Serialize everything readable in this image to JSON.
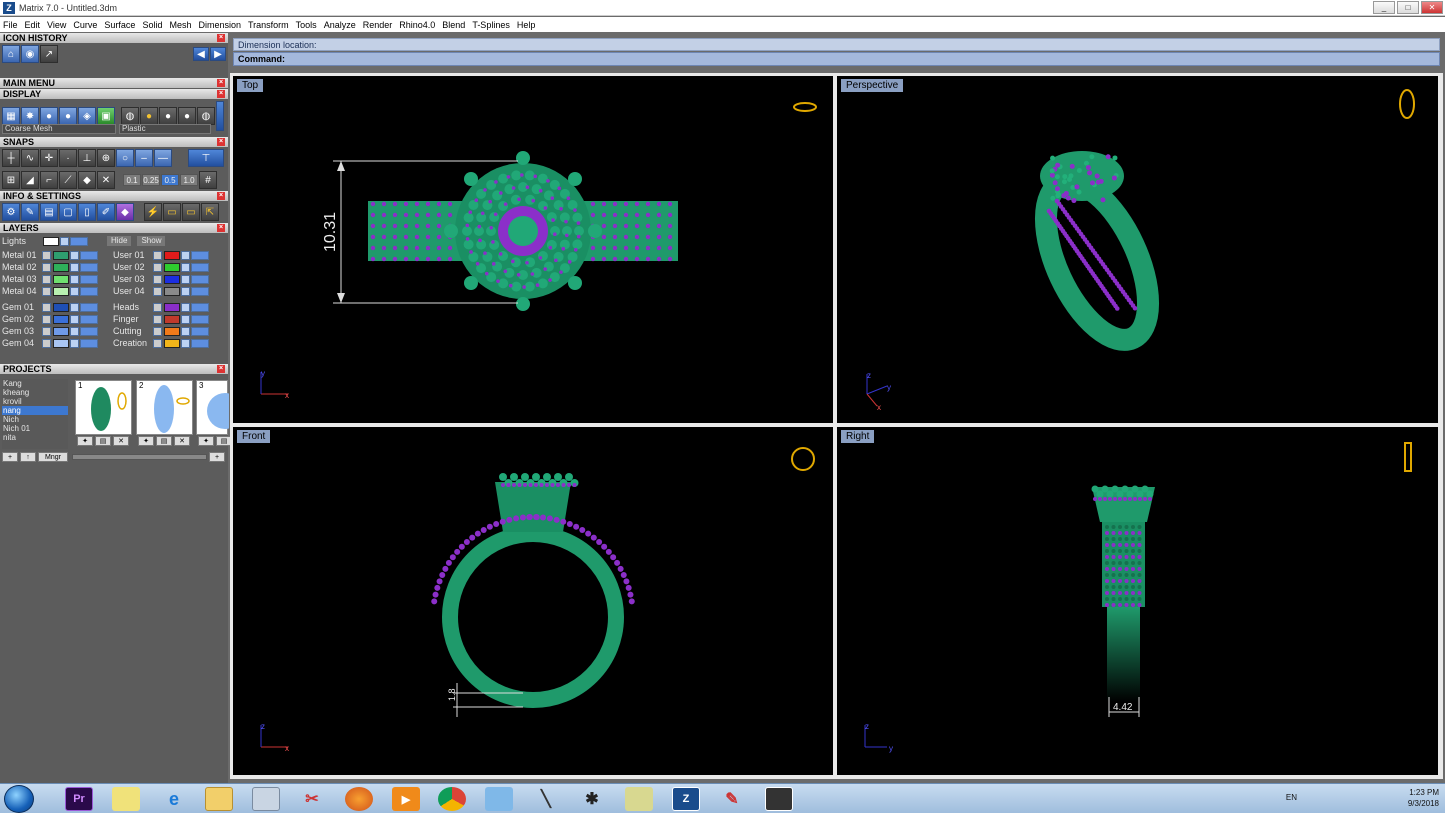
{
  "window": {
    "title": "Matrix 7.0 - Untitled.3dm",
    "logo": "Z",
    "min": "_",
    "max": "□",
    "close": "✕"
  },
  "menu": [
    "File",
    "Edit",
    "View",
    "Curve",
    "Surface",
    "Solid",
    "Mesh",
    "Dimension",
    "Transform",
    "Tools",
    "Analyze",
    "Render",
    "Rhino4.0",
    "Blend",
    "T-Splines",
    "Help"
  ],
  "panels": {
    "icon_history": "ICON HISTORY",
    "main_menu": "MAIN MENU",
    "display": "DISPLAY",
    "display_mode": "Coarse Mesh",
    "display_material": "Plastic",
    "snaps": "SNAPS",
    "snap_values": [
      "0.1",
      "0.25",
      "0.5",
      "1.0"
    ],
    "info_settings": "INFO & SETTINGS",
    "layers": "LAYERS",
    "projects": "PROJECTS"
  },
  "layers": {
    "lights": "Lights",
    "hide": "Hide",
    "show": "Show",
    "left": [
      {
        "name": "Metal 01",
        "color": "#2e9e6f"
      },
      {
        "name": "Metal 02",
        "color": "#2eb05a"
      },
      {
        "name": "Metal 03",
        "color": "#6fe06f"
      },
      {
        "name": "Metal 04",
        "color": "#b8f0b0"
      },
      {
        "name": "Gem 01",
        "color": "#1f4fb5"
      },
      {
        "name": "Gem 02",
        "color": "#3a6fd8"
      },
      {
        "name": "Gem 03",
        "color": "#6f9ae8"
      },
      {
        "name": "Gem 04",
        "color": "#a9c5f2"
      }
    ],
    "right": [
      {
        "name": "User 01",
        "color": "#e01b1b"
      },
      {
        "name": "User 02",
        "color": "#2ecc2e"
      },
      {
        "name": "User 03",
        "color": "#1c2ee0"
      },
      {
        "name": "User 04",
        "color": "#8a8a8a"
      },
      {
        "name": "Heads",
        "color": "#8a2ec8"
      },
      {
        "name": "Finger",
        "color": "#c0392b"
      },
      {
        "name": "Cutting",
        "color": "#f07a1a"
      },
      {
        "name": "Creation",
        "color": "#f2b51a"
      }
    ]
  },
  "projects": {
    "items": [
      "Kang",
      "kheang",
      "krovil",
      "nang",
      "Nich",
      "Nich 01",
      "nita"
    ],
    "selected": "nang",
    "thumbs": [
      "1",
      "2",
      "3"
    ],
    "mngr": "Mngr"
  },
  "command": {
    "line1": "Dimension location:",
    "line2": "Command:"
  },
  "viewports": [
    {
      "label": "Top",
      "dimension": "10.31",
      "axis1": "y",
      "axis2": "x"
    },
    {
      "label": "Perspective",
      "axis1": "z",
      "axis2": "y",
      "axis3": "x"
    },
    {
      "label": "Front",
      "dimension": "1.8",
      "axis1": "z",
      "axis2": "x"
    },
    {
      "label": "Right",
      "dimension": "4.42",
      "axis1": "z",
      "axis2": "y"
    }
  ],
  "taskbar": {
    "lang": "EN",
    "time": "1:23 PM",
    "date": "9/3/2018",
    "pr": "Pr"
  },
  "colors": {
    "metal": "#1f9a6b",
    "prong": "#8b2fc9",
    "viewport_bg": "#000000",
    "label_bg": "#8a9fc2"
  }
}
